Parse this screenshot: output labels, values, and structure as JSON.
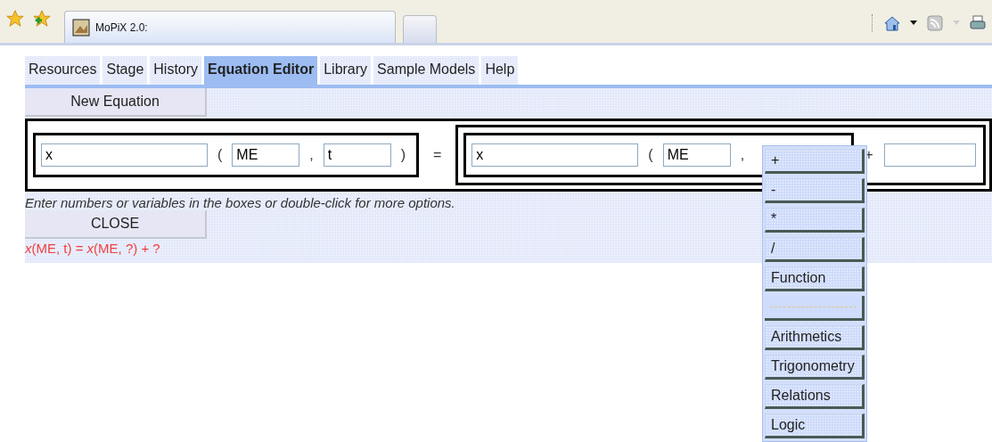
{
  "browser": {
    "tab_title": "MoPiX 2.0:"
  },
  "nav_tabs": [
    {
      "label": "Resources",
      "selected": false
    },
    {
      "label": "Stage",
      "selected": false
    },
    {
      "label": "History",
      "selected": false
    },
    {
      "label": "Equation Editor",
      "selected": true
    },
    {
      "label": "Library",
      "selected": false
    },
    {
      "label": "Sample Models",
      "selected": false
    },
    {
      "label": "Help",
      "selected": false
    }
  ],
  "new_equation_button": "New Equation",
  "equation": {
    "left": {
      "name": "x",
      "arg1": "ME",
      "arg2": "t",
      "open": "(",
      "comma": ",",
      "close": ")"
    },
    "equals": "=",
    "right": {
      "name": "x",
      "open": "(",
      "arg1": "ME",
      "comma": ",",
      "plus": "+"
    }
  },
  "hint": "Enter numbers or variables in the boxes or double-click for more options.",
  "close_button": "CLOSE",
  "formula": "*x*(ME, t) = *x*(ME, ?) + ?",
  "popup_menu": [
    {
      "kind": "item",
      "label": "+"
    },
    {
      "kind": "item",
      "label": "-"
    },
    {
      "kind": "item",
      "label": "*"
    },
    {
      "kind": "item",
      "label": "/"
    },
    {
      "kind": "item",
      "label": "Function"
    },
    {
      "kind": "separator"
    },
    {
      "kind": "item",
      "label": "Arithmetics"
    },
    {
      "kind": "item",
      "label": "Trigonometry"
    },
    {
      "kind": "item",
      "label": "Relations"
    },
    {
      "kind": "item",
      "label": "Logic"
    }
  ]
}
